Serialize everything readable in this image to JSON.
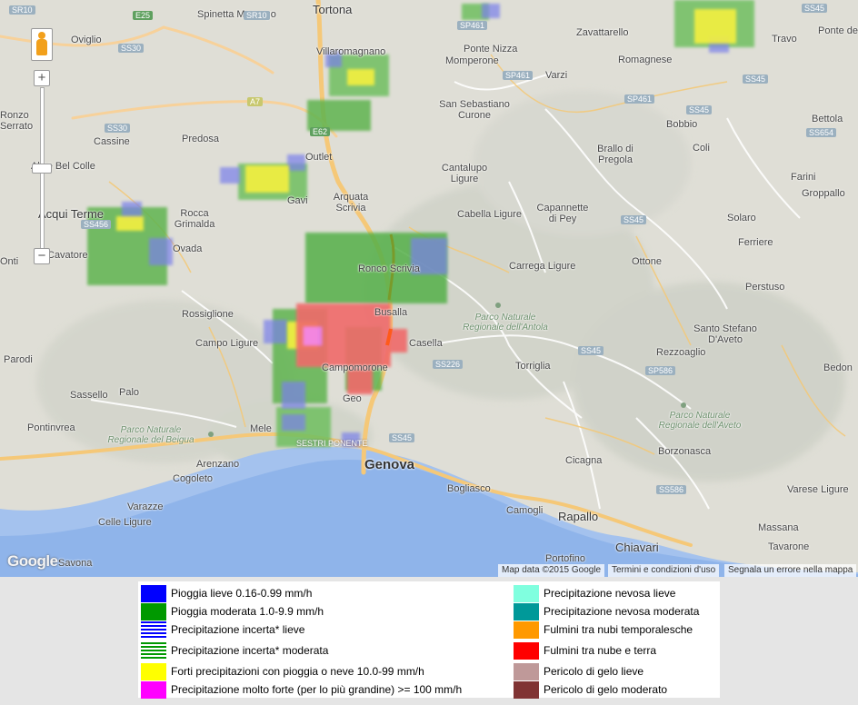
{
  "map": {
    "places_big": [
      "Genova"
    ],
    "places_mid": [
      "Tortona",
      "Acqui Terme",
      "Chiavari",
      "Rapallo"
    ],
    "places": [
      "Spinetta Marengo",
      "Oviglio",
      "Villaromagnano",
      "Ponte Nizza",
      "Zavattarello",
      "Travo",
      "Ponte de",
      "Momperone",
      "Romagnese",
      "Varzi",
      "San Sebastiano Curone",
      "Bettola",
      "Predosa",
      "Cassine",
      "Bobbio",
      "Coli",
      "Outlet",
      "Brallo di Pregola",
      "Farini",
      "Groppallo",
      "Alice Bel Colle",
      "Cantalupo Ligure",
      "Gavi",
      "Arquata Scrivia",
      "Capannette di Pey",
      "Cabella Ligure",
      "Rocca Grimalda",
      "Solaro",
      "Ovada",
      "Ferriere",
      "Cavatore",
      "Ronco Scrivia",
      "Carrega Ligure",
      "Ottone",
      "Perstuso",
      "Busalla",
      "Rossiglione",
      "Santo Stefano D'Aveto",
      "Campo Ligure",
      "Casella",
      "Rezzoaglio",
      "Bedon",
      "Parodi",
      "Torriglia",
      "Campomorone",
      "Sassello",
      "Palo",
      "Geo",
      "Pontinvrea",
      "Mele",
      "Borzonasca",
      "Arenzano",
      "Cogoleto",
      "Cicagna",
      "Bogliasco",
      "Varese Ligure",
      "Varazze",
      "Camogli",
      "Celle Ligure",
      "Massana",
      "Tavarone",
      "Portofino",
      "Savona",
      "Ronzo",
      "Serrato",
      "Onti"
    ],
    "parks": [
      "Parco Naturale Regionale dell'Antola",
      "Parco Naturale Regionale del Beigua",
      "Parco Naturale Regionale dell'Aveto"
    ],
    "roads": [
      "SR10",
      "E25",
      "SR10",
      "SP461",
      "SS45",
      "SS30",
      "A7",
      "SP461",
      "SS45",
      "SS30",
      "SP461",
      "SS45",
      "SS654",
      "E62",
      "SS456",
      "SS45",
      "SS226",
      "SS45",
      "SP586",
      "SS45",
      "SS586",
      "SESTRI PONENTE"
    ],
    "attribution": {
      "data": "Map data ©2015 Google",
      "terms": "Termini e condizioni d'uso",
      "report": "Segnala un errore nella mappa"
    },
    "google_logo": "Google",
    "controls": {
      "zoom_in": "+",
      "zoom_out": "−"
    }
  },
  "legend": {
    "left": [
      {
        "label": "Pioggia lieve 0.16-0.99 mm/h",
        "color": "#0000ff"
      },
      {
        "label": "Pioggia moderata 1.0-9.9 mm/h",
        "color": "#009900"
      },
      {
        "label": "Precipitazione incerta* lieve",
        "color": "#0000ff",
        "pattern": "stripes"
      },
      {
        "label": "Precipitazione incerta* moderata",
        "color": "#009900",
        "pattern": "stripes"
      },
      {
        "label": "Forti precipitazioni con pioggia o neve 10.0-99 mm/h",
        "color": "#ffff00"
      },
      {
        "label": "Precipitazione molto forte (per lo più grandine) >= 100 mm/h",
        "color": "#ff00ff"
      }
    ],
    "right": [
      {
        "label": "Precipitazione nevosa lieve",
        "color": "#80ffdf"
      },
      {
        "label": "Precipitazione nevosa moderata",
        "color": "#009999"
      },
      {
        "label": "Fulmini tra nubi temporalesche",
        "color": "#ff9900"
      },
      {
        "label": "Fulmini tra nube e terra",
        "color": "#ff0000"
      },
      {
        "label": "Pericolo di gelo lieve",
        "color": "#bf9999"
      },
      {
        "label": "Pericolo di gelo moderato",
        "color": "#803333"
      }
    ]
  }
}
